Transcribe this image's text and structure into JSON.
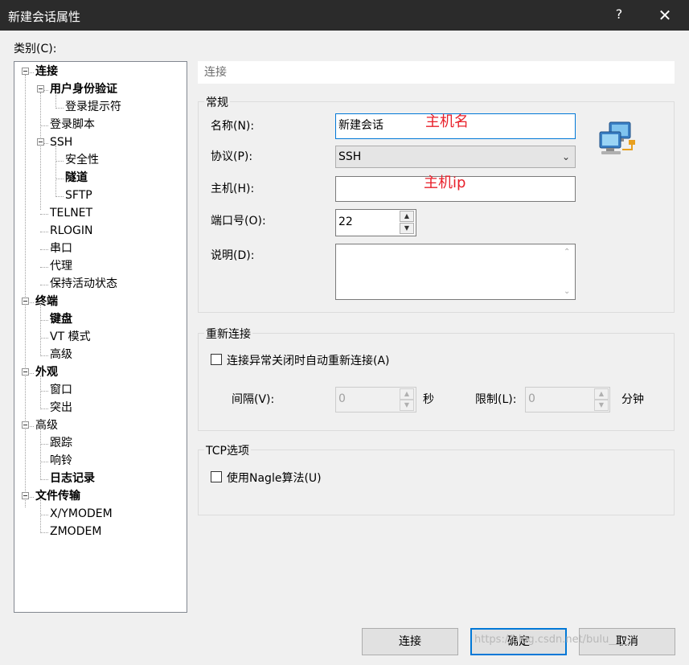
{
  "window": {
    "title": "新建会话属性",
    "help_glyph": "?",
    "close_glyph": "✕"
  },
  "category_label": "类别(C):",
  "tree": [
    {
      "label": "连接",
      "bold": true
    },
    {
      "label": "用户身份验证",
      "bold": true
    },
    {
      "label": "登录提示符",
      "bold": false
    },
    {
      "label": "登录脚本",
      "bold": false
    },
    {
      "label": "SSH",
      "bold": false
    },
    {
      "label": "安全性",
      "bold": false
    },
    {
      "label": "隧道",
      "bold": true
    },
    {
      "label": "SFTP",
      "bold": false
    },
    {
      "label": "TELNET",
      "bold": false
    },
    {
      "label": "RLOGIN",
      "bold": false
    },
    {
      "label": "串口",
      "bold": false
    },
    {
      "label": "代理",
      "bold": false
    },
    {
      "label": "保持活动状态",
      "bold": false
    },
    {
      "label": "终端",
      "bold": true
    },
    {
      "label": "键盘",
      "bold": true
    },
    {
      "label": "VT 模式",
      "bold": false
    },
    {
      "label": "高级",
      "bold": false
    },
    {
      "label": "外观",
      "bold": true
    },
    {
      "label": "窗口",
      "bold": false
    },
    {
      "label": "突出",
      "bold": false
    },
    {
      "label": "高级",
      "bold": false
    },
    {
      "label": "跟踪",
      "bold": false
    },
    {
      "label": "响铃",
      "bold": false
    },
    {
      "label": "日志记录",
      "bold": true
    },
    {
      "label": "文件传输",
      "bold": true
    },
    {
      "label": "X/YMODEM",
      "bold": false
    },
    {
      "label": "ZMODEM",
      "bold": false
    }
  ],
  "section_header": "连接",
  "general": {
    "title": "常规",
    "name_label": "名称(N):",
    "name_value": "新建会话",
    "protocol_label": "协议(P):",
    "protocol_value": "SSH",
    "host_label": "主机(H):",
    "host_value": "",
    "port_label": "端口号(O):",
    "port_value": "22",
    "desc_label": "说明(D):",
    "desc_value": "",
    "icon": "network-computers-icon"
  },
  "annotations": {
    "host_name": "主机名",
    "host_ip": "主机ip"
  },
  "reconnect": {
    "title": "重新连接",
    "checkbox_label": "连接异常关闭时自动重新连接(A)",
    "checked": false,
    "interval_label": "间隔(V):",
    "interval_value": "0",
    "interval_unit": "秒",
    "limit_label": "限制(L):",
    "limit_value": "0",
    "limit_unit": "分钟"
  },
  "tcp": {
    "title": "TCP选项",
    "nagle_label": "使用Nagle算法(U)",
    "checked": false
  },
  "buttons": {
    "connect": "连接",
    "ok": "确定",
    "cancel": "取消"
  },
  "watermark": "https://blog.csdn.net/bulu____"
}
